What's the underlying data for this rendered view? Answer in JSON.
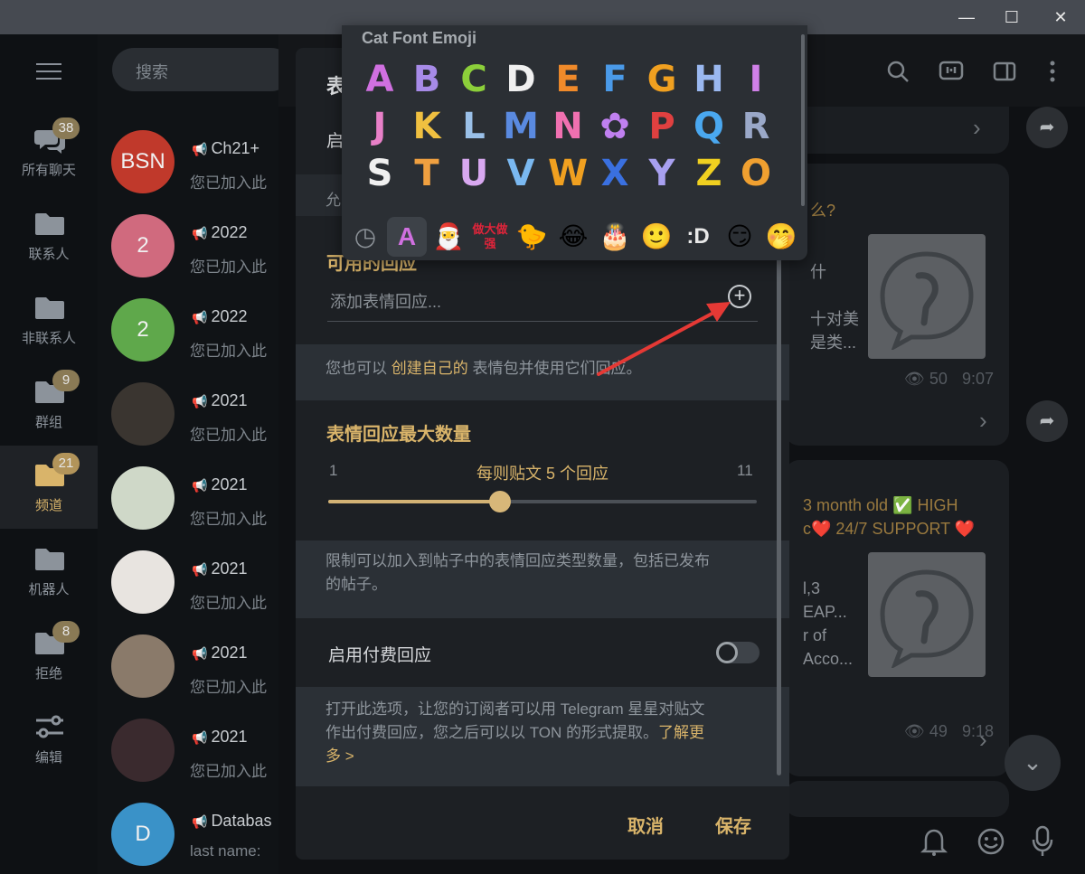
{
  "window": {
    "minimize": "—",
    "maximize": "☐",
    "close": "✕"
  },
  "folders": [
    {
      "label": "所有聊天",
      "badge": "38",
      "icon": "chats-icon"
    },
    {
      "label": "联系人",
      "badge": "",
      "icon": "folder-icon"
    },
    {
      "label": "非联系人",
      "badge": "",
      "icon": "folder-icon"
    },
    {
      "label": "群组",
      "badge": "9",
      "icon": "folder-icon"
    },
    {
      "label": "频道",
      "badge": "21",
      "icon": "folder-icon",
      "active": true
    },
    {
      "label": "机器人",
      "badge": "",
      "icon": "folder-icon"
    },
    {
      "label": "拒绝",
      "badge": "8",
      "icon": "folder-icon"
    },
    {
      "label": "编辑",
      "badge": "",
      "icon": "sliders-icon"
    }
  ],
  "search": {
    "placeholder": "搜索"
  },
  "chats": [
    {
      "avatar": "BSN",
      "color": "#c0392b",
      "title": "Ch21+",
      "subtitle": "您已加入此"
    },
    {
      "avatar": "2",
      "color": "#d06a7e",
      "title": "2022",
      "subtitle": "您已加入此"
    },
    {
      "avatar": "2",
      "color": "#5fa84b",
      "title": "2022",
      "subtitle": "您已加入此"
    },
    {
      "avatar": "",
      "color": "#3a3530",
      "title": "2021",
      "subtitle": "您已加入此"
    },
    {
      "avatar": "",
      "color": "#cfd8c8",
      "title": "2021",
      "subtitle": "您已加入此"
    },
    {
      "avatar": "",
      "color": "#e8e4e0",
      "title": "2021",
      "subtitle": "您已加入此"
    },
    {
      "avatar": "",
      "color": "#8a7a6a",
      "title": "2021",
      "subtitle": "您已加入此"
    },
    {
      "avatar": "",
      "color": "#3a2a2e",
      "title": "2021",
      "subtitle": "您已加入此"
    },
    {
      "avatar": "D",
      "color": "#3a92c8",
      "title": "Databas",
      "subtitle": "last name:"
    }
  ],
  "pane": {
    "msg1_question": "么?",
    "msg1_text": [
      "什",
      "十对美",
      "是类..."
    ],
    "msg1_views": "50",
    "msg1_time": "9:07",
    "msg2_head1": "3 month old ✅ HIGH",
    "msg2_head2": "c❤️ 24/7 SUPPORT ❤️",
    "msg2_text": [
      "l,3",
      "EAP...",
      "r of",
      "Acco..."
    ],
    "msg2_views": "49",
    "msg2_time": "9:18"
  },
  "modal": {
    "title": "表",
    "enable_row": "启",
    "hint_top": "允",
    "available_title": "可用的回应",
    "add_placeholder": "添加表情回应...",
    "create_prefix": "您也可以",
    "create_link": "创建自己的",
    "create_suffix": "表情包并使用它们回应。",
    "max_title": "表情回应最大数量",
    "slider_min": "1",
    "slider_max": "11",
    "slider_label": "每则贴文 5 个回应",
    "slider_value": 5,
    "limit_text_1": "限制可以加入到帖子中的表情回应类型数量，包括已发布",
    "limit_text_2": "的帖子。",
    "paid_label": "启用付费回应",
    "paid_enabled": false,
    "paid_text_1": "打开此选项，让您的订阅者可以用 Telegram 星星对贴文",
    "paid_text_2": "作出付费回应，您之后可以以 TON 的形式提取。",
    "learn_more_a": "了解更",
    "learn_more_b": "多 >",
    "cancel": "取消",
    "save": "保存"
  },
  "emoji_panel": {
    "title": "Cat Font Emoji",
    "letters": [
      "A",
      "B",
      "C",
      "D",
      "E",
      "F",
      "G",
      "H",
      "I",
      "J",
      "K",
      "L",
      "M",
      "N",
      "✿",
      "P",
      "Q",
      "R",
      "S",
      "T",
      "U",
      "V",
      "W",
      "X",
      "Y",
      "Z",
      "O"
    ],
    "letter_colors": [
      "#d070e0",
      "#a78be8",
      "#8ccf3a",
      "#f0f0f0",
      "#f08a2a",
      "#4a9ae8",
      "#f0a020",
      "#9ab8f0",
      "#d080e8",
      "#e880c8",
      "#f0c040",
      "#9ac0e8",
      "#5a8ae0",
      "#f070b0",
      "#c080f0",
      "#e04040",
      "#4aa8f0",
      "#9aa8c8",
      "#f0f0f0",
      "#f0a040",
      "#d8a8f0",
      "#7ab8f0",
      "#f0a020",
      "#3a70e0",
      "#a8a0f0",
      "#f0d020",
      "#f0a030"
    ],
    "tabs": [
      "recent-icon",
      "cat-font-pack",
      "sticker-pack-1",
      "做大做强",
      "sticker-pack-duck",
      "sticker-pack-laugh",
      "sticker-pack-hbd",
      "smile-pack",
      "d-pack",
      "troll-pack",
      "face-pack"
    ],
    "tab_glyphs": [
      "◷",
      "A",
      "🎅",
      "做大做强",
      "🐤",
      "😂",
      "🎂",
      "🙂",
      ":D",
      "😏",
      "🤭"
    ]
  },
  "colors": {
    "accent": "#d9b46a",
    "annotation": "#e53935"
  }
}
